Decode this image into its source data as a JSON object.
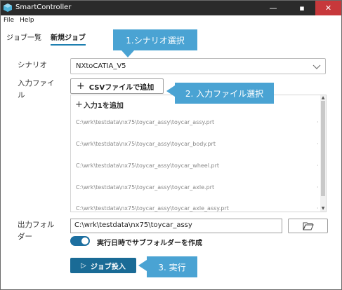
{
  "window": {
    "title": "SmartController",
    "minimize": "—",
    "maximize": "▪",
    "close": "✕"
  },
  "menu": {
    "file": "File",
    "help": "Help"
  },
  "tabs": [
    {
      "label": "ジョブ一覧"
    },
    {
      "label": "新規ジョブ"
    }
  ],
  "scenario": {
    "label": "シナリオ",
    "value": "NXtoCATIA_V5"
  },
  "input_file": {
    "label_line1": "入力ファイ",
    "label_line2": "ル",
    "csv_button": "CSVファイルで追加",
    "add_row": "入力1を追加",
    "files": [
      "C:\\wrk\\testdata\\nx75\\toycar_assy\\toycar_assy.prt",
      "C:\\wrk\\testdata\\nx75\\toycar_assy\\toycar_body.prt",
      "C:\\wrk\\testdata\\nx75\\toycar_assy\\toycar_wheel.prt",
      "C:\\wrk\\testdata\\nx75\\toycar_assy\\toycar_axle.prt",
      "C:\\wrk\\testdata\\nx75\\toycar_assy\\toycar_axle_assy.prt"
    ]
  },
  "output_folder": {
    "label_line1": "出力フォル",
    "label_line2": "ダー",
    "value": "C:\\wrk\\testdata\\nx75\\toycar_assy"
  },
  "subfolder_toggle": {
    "label": "実行日時でサブフォルダーを作成",
    "on": true
  },
  "run_button": {
    "label": "ジョブ投入"
  },
  "callouts": {
    "c1": "1.シナリオ選択",
    "c2": "2. 入力ファイル選択",
    "c3": "3. 実行"
  },
  "colors": {
    "accent": "#1a6b96",
    "callout": "#4aa3d3",
    "close": "#c7383b",
    "titlebar": "#2b2b2b"
  }
}
